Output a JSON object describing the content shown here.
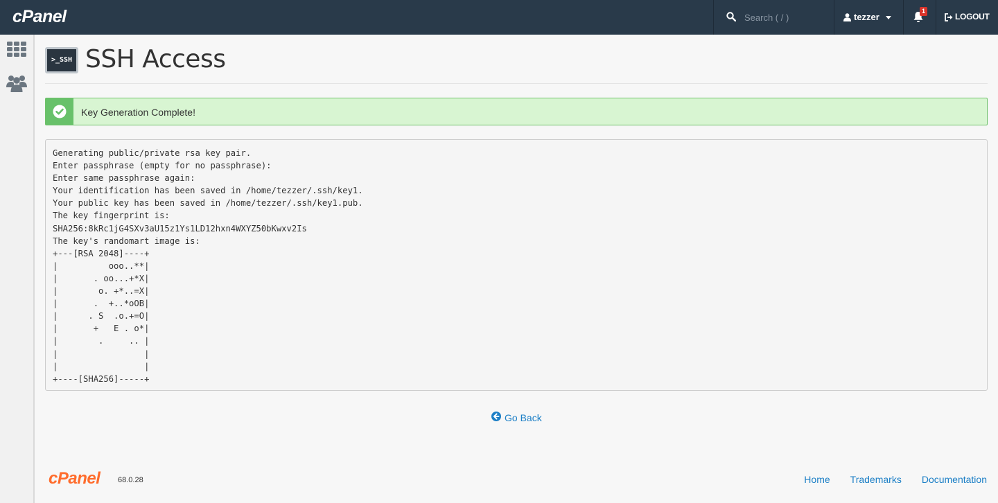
{
  "topbar": {
    "logo": "cPanel",
    "search_placeholder": "Search ( / )",
    "username": "tezzer",
    "notification_count": "1",
    "logout_label": "LOGOUT"
  },
  "sidebar": {
    "items": [
      {
        "icon": "grid-icon"
      },
      {
        "icon": "users-icon"
      }
    ]
  },
  "page": {
    "icon_label": ">_SSH",
    "title": "SSH Access",
    "alert": "Key Generation Complete!",
    "output_lines": [
      "Generating public/private rsa key pair.",
      "Enter passphrase (empty for no passphrase):",
      "Enter same passphrase again:",
      "Your identification has been saved in /home/tezzer/.ssh/key1.",
      "Your public key has been saved in /home/tezzer/.ssh/key1.pub.",
      "The key fingerprint is:",
      "SHA256:8kRc1jG4SXv3aU15z1Ys1LD12hxn4WXYZ50bKwxv2Is",
      "The key's randomart image is:",
      "+---[RSA 2048]----+",
      "|          ooo..**|",
      "|       . oo...+*X|",
      "|        o. +*..=X|",
      "|       .  +..*oOB|",
      "|      . S  .o.+=O|",
      "|       +   E . o*|",
      "|        .     .. |",
      "|                 |",
      "|                 |",
      "+----[SHA256]-----+"
    ],
    "go_back": "Go Back"
  },
  "footer": {
    "logo": "cPanel",
    "version": "68.0.28",
    "links": [
      "Home",
      "Trademarks",
      "Documentation"
    ]
  }
}
